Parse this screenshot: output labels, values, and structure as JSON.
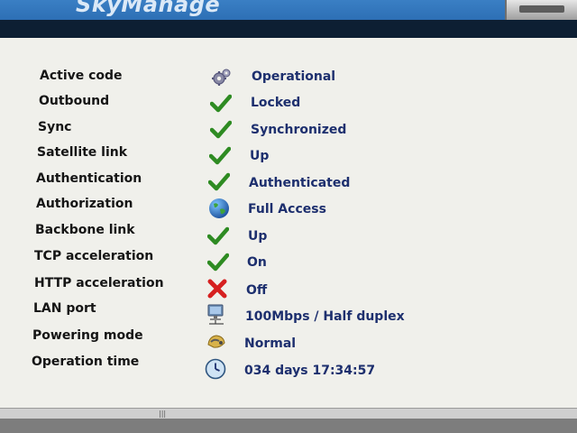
{
  "header": {
    "title": "SkyManage"
  },
  "status_rows": [
    {
      "label": "Active code",
      "icon": "gears-icon",
      "value": "Operational"
    },
    {
      "label": "Outbound",
      "icon": "check-icon",
      "value": "Locked"
    },
    {
      "label": "Sync",
      "icon": "check-icon",
      "value": "Synchronized"
    },
    {
      "label": "Satellite link",
      "icon": "check-icon",
      "value": "Up"
    },
    {
      "label": "Authentication",
      "icon": "check-icon",
      "value": "Authenticated"
    },
    {
      "label": "Authorization",
      "icon": "globe-icon",
      "value": "Full Access"
    },
    {
      "label": "Backbone link",
      "icon": "check-icon",
      "value": "Up"
    },
    {
      "label": "TCP acceleration",
      "icon": "check-icon",
      "value": "On"
    },
    {
      "label": "HTTP acceleration",
      "icon": "cross-icon",
      "value": "Off"
    },
    {
      "label": "LAN port",
      "icon": "computer-network-icon",
      "value": "100Mbps / Half duplex"
    },
    {
      "label": "Powering mode",
      "icon": "power-plug-icon",
      "value": "Normal"
    },
    {
      "label": "Operation time",
      "icon": "clock-icon",
      "value": "034 days 17:34:57"
    }
  ],
  "colors": {
    "banner": "#2d6fb5",
    "value_text": "#1d2f6e",
    "check_green": "#2e8b22",
    "cross_red": "#d62020"
  }
}
